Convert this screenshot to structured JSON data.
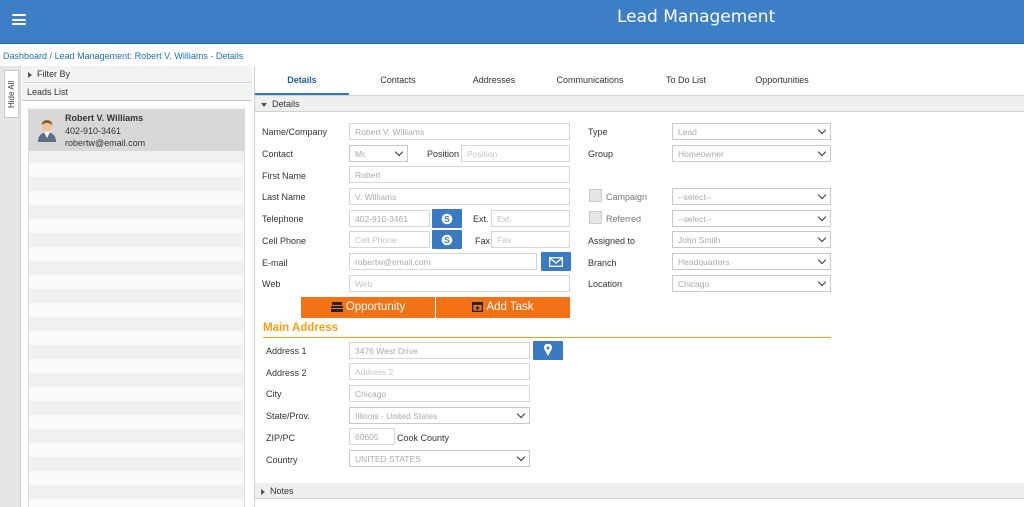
{
  "header": {
    "title": "Lead Management"
  },
  "breadcrumb": {
    "home": "Dashboard",
    "current": "Lead Management: Robert V. Williams - Details",
    "separator": "/"
  },
  "sidebar": {
    "hide_label": "Hide All",
    "filter_label": "Filter By",
    "leads_label": "Leads List",
    "lead": {
      "name": "Robert V. Williams",
      "phone": "402-910-3461",
      "email": "robertw@email.com"
    }
  },
  "tabs": [
    "Details",
    "Contacts",
    "Addresses",
    "Communications",
    "To Do List",
    "Opportunities"
  ],
  "details": {
    "section_label": "Details",
    "labels": {
      "name_company": "Name/Company",
      "contact": "Contact",
      "position": "Position",
      "first_name": "First Name",
      "last_name": "Last Name",
      "telephone": "Telephone",
      "ext": "Ext.",
      "cell_phone": "Cell Phone",
      "fax": "Fax",
      "email": "E-mail",
      "web": "Web",
      "type": "Type",
      "group": "Group",
      "campaign": "Campaign",
      "referred": "Referred",
      "assigned_to": "Assigned to",
      "branch": "Branch",
      "location": "Location"
    },
    "values": {
      "name_company": "Robert V. Williams",
      "contact": "Mr.",
      "position_placeholder": "Position",
      "first_name": "Robert",
      "last_name": "V. Williams",
      "telephone": "402-910-3461",
      "ext_placeholder": "Ext.",
      "cell_placeholder": "Cell Phone",
      "fax_placeholder": "Fax",
      "email": "robertw@email.com",
      "web_placeholder": "Web",
      "type": "Lead",
      "group": "Homeowner",
      "campaign": "--select--",
      "referred": "--select--",
      "assigned_to": "John Smith",
      "branch": "Headquarters",
      "location": "Chicago"
    },
    "buttons": {
      "opportunity": "Opportunity",
      "add_task": "Add Task"
    }
  },
  "address": {
    "title": "Main Address",
    "labels": {
      "address1": "Address 1",
      "address2": "Address 2",
      "city": "City",
      "state": "State/Prov.",
      "zip": "ZIP/PC",
      "country": "Country"
    },
    "values": {
      "address1": "3476 West Drive",
      "address2_placeholder": "Address 2",
      "city": "Chicago",
      "state": "Illinois - United States",
      "zip": "60605",
      "county": "Cook County",
      "country": "UNITED STATES"
    }
  },
  "notes": {
    "section_label": "Notes"
  },
  "colors": {
    "header_blue": "#3c7fc6",
    "accent_orange": "#f47216",
    "section_orange": "#f5a00f",
    "link_blue": "#1e6fb8"
  },
  "icons": {
    "menu": "hamburger-icon",
    "skype": "skype-icon",
    "mail": "envelope-icon",
    "map": "map-pin-icon",
    "opportunity": "cash-register-icon",
    "task": "calendar-plus-icon",
    "avatar": "user-avatar-icon"
  }
}
